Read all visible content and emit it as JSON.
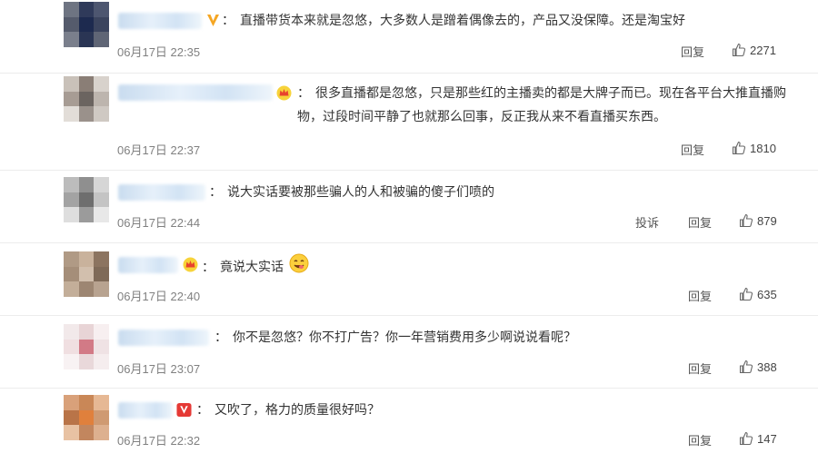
{
  "comments": [
    {
      "text": "直播带货本来就是忽悠，大多数人是蹭着偶像去的，产品又没保障。还是淘宝好",
      "time": "06月17日 22:35",
      "reply": "回复",
      "likes": "2271",
      "badge": "verified-v-icon"
    },
    {
      "text": "很多直播都是忽悠，只是那些红的主播卖的都是大牌子而已。现在各平台大推直播购物，过段时间平静了也就那么回事，反正我从来不看直播买东西。",
      "time": "06月17日 22:37",
      "reply": "回复",
      "likes": "1810",
      "badge": "crown-icon"
    },
    {
      "text": "说大实话要被那些骗人的人和被骗的傻子们喷的",
      "time": "06月17日 22:44",
      "report": "投诉",
      "reply": "回复",
      "likes": "879"
    },
    {
      "text": "竟说大实话",
      "time": "06月17日 22:40",
      "reply": "回复",
      "likes": "635",
      "badge": "crown-icon",
      "emoji": "yum-face-emoji"
    },
    {
      "text": "你不是忽悠？你不打广告？你一年营销费用多少啊说说看呢？",
      "time": "06月17日 23:07",
      "reply": "回复",
      "likes": "388"
    },
    {
      "text": "又吹了，格力的质量很好吗？",
      "time": "06月17日 22:32",
      "reply": "回复",
      "likes": "147",
      "badge": "vip-v-icon"
    }
  ],
  "colon": "：",
  "colors": {
    "text": "#333333",
    "time": "#808080",
    "divider": "#ececec",
    "verified_gold": "#f5a623",
    "vip_red": "#e53935"
  }
}
